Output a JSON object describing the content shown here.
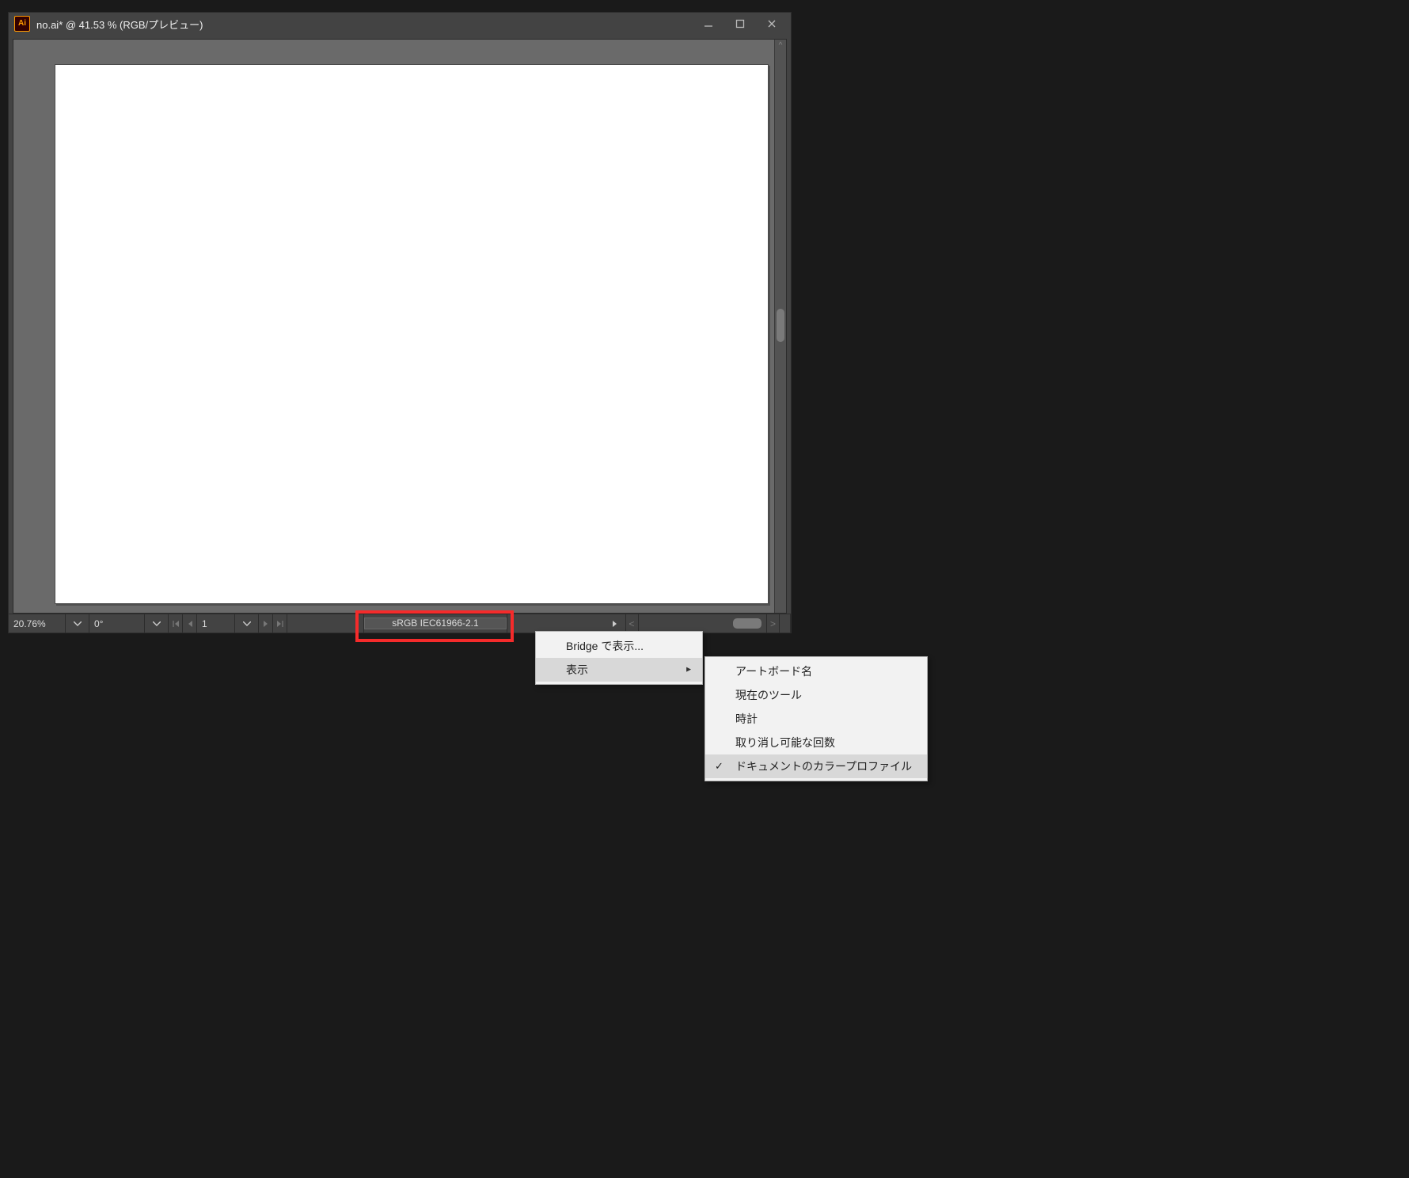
{
  "app_icon_text": "Ai",
  "title": "no.ai* @ 41.53 % (RGB/プレビュー)",
  "statusbar": {
    "zoom": "20.76%",
    "rotation": "0°",
    "page": "1",
    "color_profile": "sRGB IEC61966-2.1"
  },
  "menu1": {
    "items": [
      {
        "label": "Bridge で表示...",
        "selected": false,
        "submenu": false
      },
      {
        "label": "表示",
        "selected": true,
        "submenu": true
      }
    ]
  },
  "menu2": {
    "items": [
      {
        "label": "アートボード名",
        "checked": false
      },
      {
        "label": "現在のツール",
        "checked": false
      },
      {
        "label": "時計",
        "checked": false
      },
      {
        "label": "取り消し可能な回数",
        "checked": false
      },
      {
        "label": "ドキュメントのカラープロファイル",
        "checked": true
      }
    ]
  }
}
